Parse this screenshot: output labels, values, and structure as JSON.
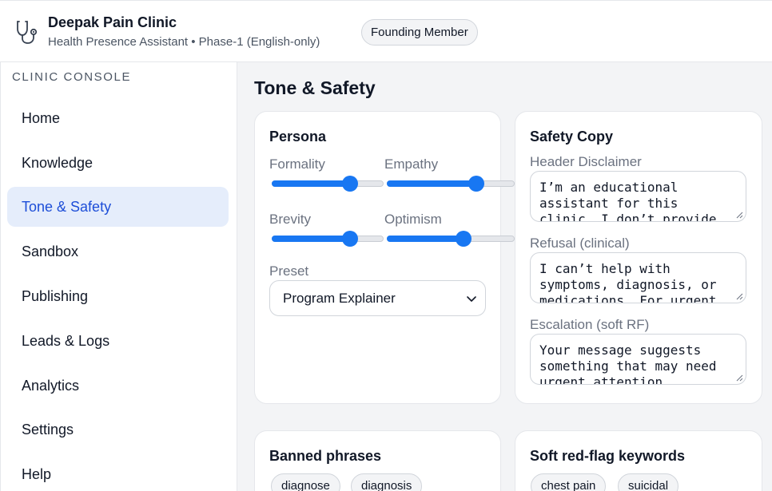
{
  "header": {
    "clinic_name": "Deepak Pain Clinic",
    "subtitle": "Health Presence Assistant • Phase-1 (English-only)",
    "badge": "Founding Member",
    "logo_icon": "stethoscope-icon"
  },
  "sidebar": {
    "section_label": "CLINIC CONSOLE",
    "active": "Tone & Safety",
    "items": [
      {
        "label": "Home"
      },
      {
        "label": "Knowledge"
      },
      {
        "label": "Tone & Safety"
      },
      {
        "label": "Sandbox"
      },
      {
        "label": "Publishing"
      },
      {
        "label": "Leads & Logs"
      },
      {
        "label": "Analytics"
      },
      {
        "label": "Settings"
      },
      {
        "label": "Help"
      }
    ]
  },
  "main": {
    "title": "Tone & Safety",
    "persona": {
      "title": "Persona",
      "sliders": [
        {
          "label": "Formality",
          "value": 0.7
        },
        {
          "label": "Empathy",
          "value": 0.7
        },
        {
          "label": "Brevity",
          "value": 0.7
        },
        {
          "label": "Optimism",
          "value": 0.6
        }
      ],
      "preset_label": "Preset",
      "preset_value": "Program Explainer"
    },
    "safety": {
      "title": "Safety Copy",
      "fields": [
        {
          "label": "Header Disclaimer",
          "value": "I’m an educational\nassistant for this\nclinic. I don’t provide"
        },
        {
          "label": "Refusal (clinical)",
          "value": "I can’t help with\nsymptoms, diagnosis, or\nmedications. For urgent"
        },
        {
          "label": "Escalation (soft RF)",
          "value": "Your message suggests\nsomething that may need\nurgent attention."
        }
      ]
    },
    "banned": {
      "title": "Banned phrases",
      "chips": [
        "diagnose",
        "diagnosis"
      ]
    },
    "redflag": {
      "title": "Soft red-flag keywords",
      "chips": [
        "chest pain",
        "suicidal"
      ]
    }
  },
  "colors": {
    "accent": "#1877f2",
    "active_nav_bg": "#e5edfb",
    "active_nav_text": "#1d4ed8"
  }
}
